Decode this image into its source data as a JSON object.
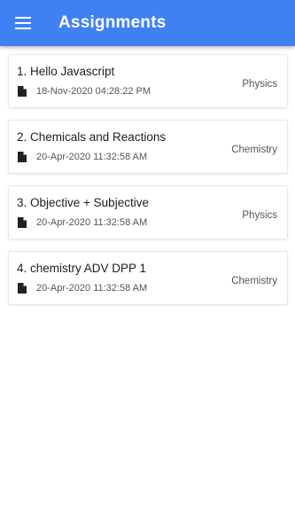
{
  "appbar": {
    "title": "Assignments",
    "menu_icon": "menu-icon",
    "color": "#3f81f4"
  },
  "assignments": [
    {
      "title": "1. Hello Javascript",
      "date": "18-Nov-2020 04:28:22 PM",
      "subject": "Physics",
      "icon": "file-icon"
    },
    {
      "title": "2. Chemicals and Reactions",
      "date": "20-Apr-2020 11:32:58 AM",
      "subject": "Chemistry",
      "icon": "file-icon"
    },
    {
      "title": "3. Objective + Subjective",
      "date": "20-Apr-2020 11:32:58 AM",
      "subject": "Physics",
      "icon": "file-icon"
    },
    {
      "title": "4. chemistry ADV DPP 1",
      "date": "20-Apr-2020 11:32:58 AM",
      "subject": "Chemistry",
      "icon": "file-icon"
    }
  ]
}
